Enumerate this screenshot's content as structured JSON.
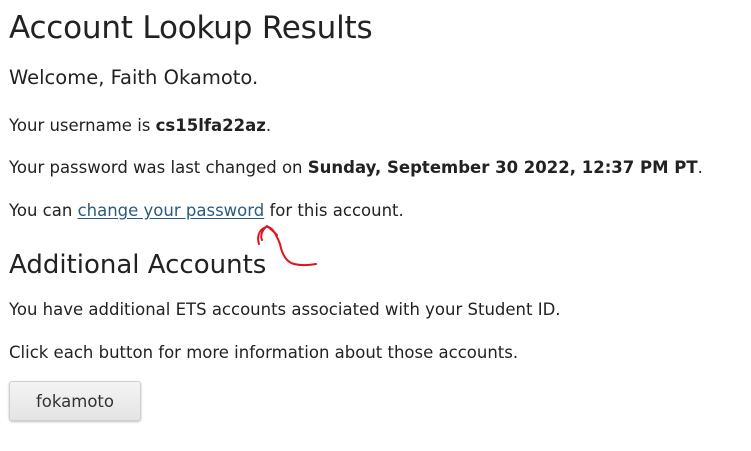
{
  "page": {
    "title": "Account Lookup Results",
    "welcome": "Welcome, Faith Okamoto."
  },
  "username_line": {
    "prefix": "Your username is ",
    "username": "cs15lfa22az",
    "suffix": "."
  },
  "password_line": {
    "prefix": "Your password was last changed on ",
    "date": "Sunday, September 30 2022, 12:37 PM PT",
    "suffix": "."
  },
  "change_line": {
    "prefix": "You can ",
    "link_label": "change your password",
    "suffix": " for this account."
  },
  "additional": {
    "heading": "Additional Accounts",
    "description": "You have additional ETS accounts associated with your Student ID.",
    "instruction": "Click each button for more information about those accounts.",
    "accounts": [
      "fokamoto"
    ]
  },
  "annotation": {
    "color": "#e0141e",
    "shape": "red-hand-drawn-arrow"
  }
}
